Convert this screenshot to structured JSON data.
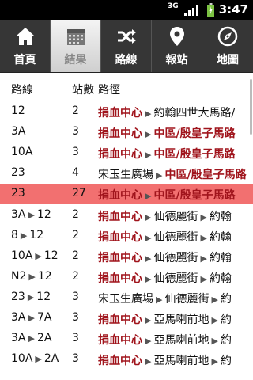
{
  "statusbar": {
    "network": "3G",
    "time": "3:47"
  },
  "tabs": [
    {
      "label": "首頁",
      "icon": "home-icon",
      "active": false
    },
    {
      "label": "結果",
      "icon": "calendar-icon",
      "active": true
    },
    {
      "label": "路線",
      "icon": "shuffle-icon",
      "active": false
    },
    {
      "label": "報站",
      "icon": "location-pin-icon",
      "active": false
    },
    {
      "label": "地圖",
      "icon": "compass-icon",
      "active": false
    }
  ],
  "table": {
    "headers": {
      "route": "路線",
      "stops": "站數",
      "path": "路徑"
    },
    "rows": [
      {
        "route": [
          "12"
        ],
        "stops": "2",
        "path": [
          {
            "t": "捐血中心",
            "s": "red"
          },
          {
            "t": "約翰四世大馬路/",
            "s": "dark"
          }
        ],
        "highlight": false
      },
      {
        "route": [
          "3A"
        ],
        "stops": "3",
        "path": [
          {
            "t": "捐血中心",
            "s": "red"
          },
          {
            "t": "中區/殷皇子馬路",
            "s": "red"
          }
        ],
        "highlight": false
      },
      {
        "route": [
          "10A"
        ],
        "stops": "3",
        "path": [
          {
            "t": "捐血中心",
            "s": "red"
          },
          {
            "t": "中區/殷皇子馬路",
            "s": "red"
          }
        ],
        "highlight": false
      },
      {
        "route": [
          "23"
        ],
        "stops": "4",
        "path": [
          {
            "t": "宋玉生廣場",
            "s": "dark"
          },
          {
            "t": "中區/殷皇子馬路",
            "s": "red"
          }
        ],
        "highlight": false
      },
      {
        "route": [
          "23"
        ],
        "stops": "27",
        "path": [
          {
            "t": "捐血中心",
            "s": "red"
          },
          {
            "t": "中區/殷皇子馬路",
            "s": "red"
          }
        ],
        "highlight": true
      },
      {
        "route": [
          "3A",
          "12"
        ],
        "stops": "2",
        "path": [
          {
            "t": "捐血中心",
            "s": "red"
          },
          {
            "t": "仙德麗街",
            "s": "dark"
          },
          {
            "t": "約翰",
            "s": "dark"
          }
        ],
        "highlight": false
      },
      {
        "route": [
          "8",
          "12"
        ],
        "stops": "2",
        "path": [
          {
            "t": "捐血中心",
            "s": "red"
          },
          {
            "t": "仙德麗街",
            "s": "dark"
          },
          {
            "t": "約翰",
            "s": "dark"
          }
        ],
        "highlight": false
      },
      {
        "route": [
          "10A",
          "12"
        ],
        "stops": "2",
        "path": [
          {
            "t": "捐血中心",
            "s": "red"
          },
          {
            "t": "仙德麗街",
            "s": "dark"
          },
          {
            "t": "約翰",
            "s": "dark"
          }
        ],
        "highlight": false
      },
      {
        "route": [
          "N2",
          "12"
        ],
        "stops": "2",
        "path": [
          {
            "t": "捐血中心",
            "s": "red"
          },
          {
            "t": "仙德麗街",
            "s": "dark"
          },
          {
            "t": "約翰",
            "s": "dark"
          }
        ],
        "highlight": false
      },
      {
        "route": [
          "23",
          "12"
        ],
        "stops": "3",
        "path": [
          {
            "t": "宋玉生廣場",
            "s": "dark"
          },
          {
            "t": "仙德麗街",
            "s": "dark"
          },
          {
            "t": "約",
            "s": "dark"
          }
        ],
        "highlight": false
      },
      {
        "route": [
          "3A",
          "7A"
        ],
        "stops": "3",
        "path": [
          {
            "t": "捐血中心",
            "s": "red"
          },
          {
            "t": "亞馬喇前地",
            "s": "dark"
          },
          {
            "t": "約",
            "s": "dark"
          }
        ],
        "highlight": false
      },
      {
        "route": [
          "3A",
          "2A"
        ],
        "stops": "3",
        "path": [
          {
            "t": "捐血中心",
            "s": "red"
          },
          {
            "t": "亞馬喇前地",
            "s": "dark"
          },
          {
            "t": "約",
            "s": "dark"
          }
        ],
        "highlight": false
      },
      {
        "route": [
          "10A",
          "2A"
        ],
        "stops": "3",
        "path": [
          {
            "t": "捐血中心",
            "s": "red"
          },
          {
            "t": "亞馬喇前地",
            "s": "dark"
          },
          {
            "t": "約",
            "s": "dark"
          }
        ],
        "highlight": false
      }
    ]
  },
  "colors": {
    "highlight": "#f27070",
    "accent_red": "#a0141c",
    "tabbar": "#363636"
  }
}
